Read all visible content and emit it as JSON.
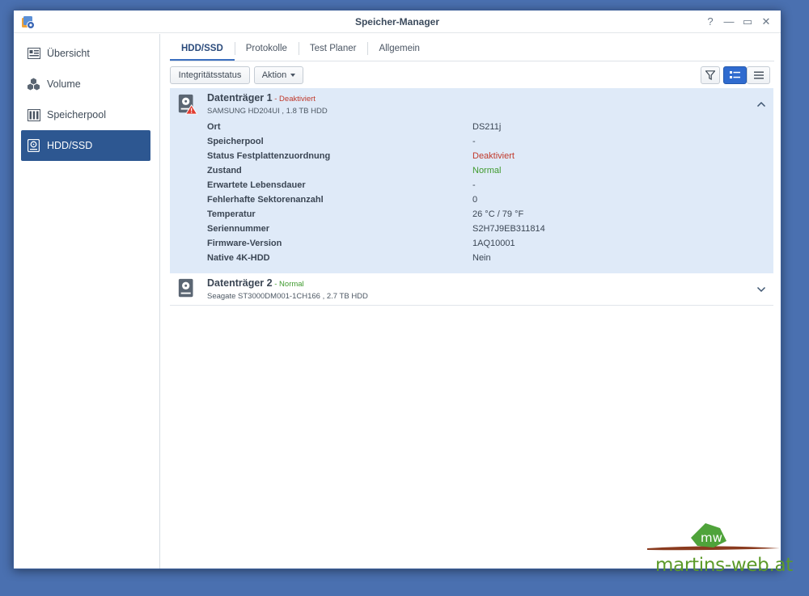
{
  "window": {
    "title": "Speicher-Manager",
    "controls": {
      "help": "?",
      "minimize": "—",
      "maximize": "▭",
      "close": "✕"
    }
  },
  "sidebar": {
    "items": [
      {
        "label": "Übersicht",
        "icon": "overview-icon",
        "active": false
      },
      {
        "label": "Volume",
        "icon": "volume-icon",
        "active": false
      },
      {
        "label": "Speicherpool",
        "icon": "storage-pool-icon",
        "active": false
      },
      {
        "label": "HDD/SSD",
        "icon": "hdd-icon",
        "active": true
      }
    ]
  },
  "tabs": [
    {
      "label": "HDD/SSD",
      "active": true
    },
    {
      "label": "Protokolle",
      "active": false
    },
    {
      "label": "Test Planer",
      "active": false
    },
    {
      "label": "Allgemein",
      "active": false
    }
  ],
  "toolbar": {
    "integrity_label": "Integritätsstatus",
    "action_label": "Aktion",
    "icons": [
      "filter-icon",
      "detail-view-icon",
      "list-view-icon"
    ]
  },
  "disks": [
    {
      "name": "Datenträger 1",
      "status": "Deaktiviert",
      "status_sep": " - ",
      "model": "SAMSUNG HD204UI , 1.8 TB HDD",
      "expanded": true,
      "details": [
        {
          "key": "Ort",
          "value": "DS211j"
        },
        {
          "key": "Speicherpool",
          "value": "-"
        },
        {
          "key": "Status Festplattenzuordnung",
          "value": "Deaktiviert"
        },
        {
          "key": "Zustand",
          "value": "Normal"
        },
        {
          "key": "Erwartete Lebensdauer",
          "value": "-"
        },
        {
          "key": "Fehlerhafte Sektorenanzahl",
          "value": "0"
        },
        {
          "key": "Temperatur",
          "value": "26 °C / 79 °F"
        },
        {
          "key": "Seriennummer",
          "value": "S2H7J9EB311814"
        },
        {
          "key": "Firmware-Version",
          "value": "1AQ10001"
        },
        {
          "key": "Native 4K-HDD",
          "value": "Nein"
        }
      ]
    },
    {
      "name": "Datenträger 2",
      "status": "Normal",
      "status_sep": " - ",
      "model": "Seagate ST3000DM001-1CH166 , 2.7 TB HDD",
      "expanded": false
    }
  ],
  "watermark": {
    "badge": "mw",
    "text": "martins-web.at"
  },
  "colors": {
    "accent": "#2d5791",
    "selected_row": "#dfeaf8",
    "status_red": "#c0392b",
    "status_green": "#3f9a2e",
    "desktop": "#4a70b0"
  }
}
